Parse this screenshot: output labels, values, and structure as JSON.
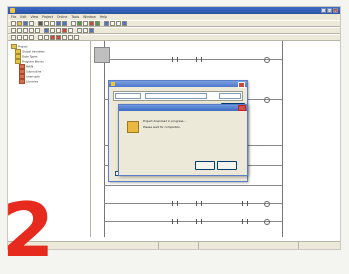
{
  "window": {
    "title": "",
    "menu": [
      "File",
      "Edit",
      "View",
      "Project",
      "Online",
      "Tools",
      "Window",
      "Help"
    ]
  },
  "sidebar": {
    "items": [
      {
        "label": "Project",
        "icon": "folder-icon",
        "indent": 0
      },
      {
        "label": "Global Variables",
        "icon": "folder-icon",
        "indent": 1
      },
      {
        "label": "Data Types",
        "icon": "folder-icon",
        "indent": 1
      },
      {
        "label": "Program Blocks",
        "icon": "folder-icon",
        "indent": 1
      },
      {
        "label": "MAIN",
        "icon": "document-icon",
        "indent": 2
      },
      {
        "label": "Subroutine",
        "icon": "document-icon",
        "indent": 2
      },
      {
        "label": "Interrupts",
        "icon": "document-icon",
        "indent": 2
      },
      {
        "label": "Libraries",
        "icon": "document-icon",
        "indent": 2
      }
    ]
  },
  "outer_dialog": {
    "title": "",
    "checkbox_label": ""
  },
  "inner_dialog": {
    "lines": [
      "Project download in progress...",
      "Please wait for completion."
    ]
  },
  "statusbar": {
    "cells": [
      "",
      "",
      ""
    ]
  },
  "step": {
    "number": "2"
  },
  "colors": {
    "accent": "#2a52a6",
    "step_number": "#e62b1e",
    "close_highlight": "#cc2020"
  }
}
